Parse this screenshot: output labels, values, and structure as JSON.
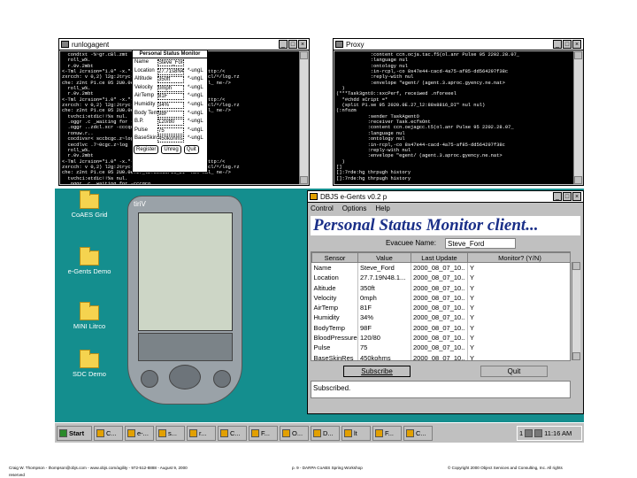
{
  "term1": {
    "title": "runlogagent",
    "lines": [
      "  condtxt -%~gr.cBl.zmt",
      "  roll_w%.",
      "  r.0v.2mbt",
      "<-Tml Jcrsion=\"1.0\" -x.\"-U. cMx logacccqe 6xKiE\" \"nttp:/<",
      "zxrcch: v 0,2) l2g:Jtryc- /ccz 2.15/icx7lx/bil7%cl2cl/^/log.rz",
      "che: z2nt P1.ce 95 2U0.0e.27_l2:86sd8/16_DI\" nul nul_ ne-/>",
      "  roll_w%.",
      "  r.0v.2mbt",
      "<-Tml Jcrsion=\"1.0\" -x.\"-U. cMx logacccqe 6xKiE\" \"nttp:/<",
      "zxrcch: v 0,2) l2g:Jtryc- /ccz 2.15/icx7lx/bil7%cl2cl/^/log.rz",
      "che: z2nt P1.ce 95 2U0.0e.27_l2:86sd8/16_DI\" nul nul_ ne-/>",
      "  tvchci:etdic!!%s nul.",
      "",
      "  .oggr .c _waiting for -cccqco",
      "  .oggr ..zdcl.xcr -cccqco",
      "  ronuw.r..",
      "  cocdivsr< sccbcgc.z~log",
      "  cecdlvc .7~0cgc.z~log",
      "  roll_w%.",
      "  r.0v.2mbt",
      "<-Tml Jcrsion=\"1.0\" -x.\"-U. cMx logacccqe 6xKiE\" \"nttp:/<",
      "zxrcch: v 0,2) l2g:Jtryc- /ccz 2.15/icx7lx/bil7%cl2cl/^/log.rz",
      "che: z2nt P1.ce 95 2U0.0e.27_l2:86sd8/16_DI\" nul nul_ ne-/>",
      "  tvchci:etdic!!%s nul.",
      "",
      "  .oggr .c _waiting for -cccqco",
      "  .oggr ..zdcl.xcr -cccqco"
    ]
  },
  "term2": {
    "title": "Proxy",
    "lines": [
      "            :content ccn.ocja.tac.f5(ol.anr Pulse 95 2202.28.07_",
      "            :language nul",
      "            :ontology nul",
      "            :in-rcpl,-co 8s47e44-cacd-4a75-af85-dd564297f38c",
      "            :reply-w1th nul",
      "            :envelope \"egent/ (agent.3.aproc.gyency.ne.nat>",
      "  )",
      "(***Task3gntO::sxcPerf, receiwed .nforeeel",
      "  *#chdd sCript =*",
      "  (split P1.se 95 2020.0E.27_l2:88s8816_DI\" nul nul)",
      "",
      "(:nfozm",
      "           :sender TaskAgentO",
      "           :receiver Task.ecfsOnt",
      "           :content ccn.oejagcc.t5(ol.anr Pulse 95 2202.28.07_",
      "           :language nul",
      "           :ontology nul",
      "           :in-rcpl,-co 8s47e44-cacd-4a75-af85-dd564297f38c",
      "           :reply-w1th nul",
      "           :envelope \"egent/ (agent.3.aproc.gyency.ne.nat>",
      "  )",
      "[]",
      "[]:7rde:hg thrpugh history",
      "[]:7rde:hg thrpugh history"
    ]
  },
  "desktop_icons": [
    "CoAES Grid",
    "e-Gents Demo",
    "MINI Litrco",
    "SDC Demo"
  ],
  "palm": {
    "title": "tiriV",
    "form_title": "Personal Status Monitor",
    "rows": [
      {
        "l": "Name",
        "v": "Steve_Ford",
        "a": ""
      },
      {
        "l": "Location",
        "v": "27.71s8N48.1",
        "a": "*-ungL"
      },
      {
        "l": "Altitude",
        "v": "350ft",
        "a": "*-ungL"
      },
      {
        "l": "Velocity",
        "v": "0mph",
        "a": "*-ungL"
      },
      {
        "l": "AirTemp",
        "v": "81F",
        "a": "*-ungL"
      },
      {
        "l": "Humidity",
        "v": "34%",
        "a": "*-ungL"
      },
      {
        "l": "Body Temp",
        "v": "98F",
        "a": "*-ungL"
      },
      {
        "l": "B.P.",
        "v": "120/80",
        "a": "*-ungL"
      },
      {
        "l": "Pulse",
        "v": "75",
        "a": "*-ungL"
      },
      {
        "l": "BaseSkin",
        "v": "450kohms",
        "a": "*-ungL"
      }
    ],
    "buttons": [
      "Register",
      "Unreg",
      "Quit"
    ]
  },
  "client": {
    "title": "DBJS e-Gents v0.2 p",
    "menu": [
      "Control",
      "Options",
      "Help"
    ],
    "heading": "Personal Status Monitor client...",
    "evacuee_label": "Evacuee Name:",
    "evacuee_value": "Steve_Ford",
    "columns": [
      "Sensor",
      "Value",
      "Last Update",
      "Monitor? (Y/N)"
    ],
    "rows": [
      [
        "Name",
        "Steve_Ford",
        "2000_08_07_10..",
        "Y"
      ],
      [
        "Location",
        "27.7.19N48.1...",
        "2000_08_07_10..",
        "Y"
      ],
      [
        "Altitude",
        "350ft",
        "2000_08_07_10..",
        "Y"
      ],
      [
        "Velocity",
        "0mph",
        "2000_08_07_10..",
        "Y"
      ],
      [
        "AirTemp",
        "81F",
        "2000_08_07_10..",
        "Y"
      ],
      [
        "Humidity",
        "34%",
        "2000_08_07_10..",
        "Y"
      ],
      [
        "BodyTemp",
        "98F",
        "2000_08_07_10..",
        "Y"
      ],
      [
        "BloodPressure",
        "120/80",
        "2000_08_07_10..",
        "Y"
      ],
      [
        "Pulse",
        "75",
        "2000_08_07_10..",
        "Y"
      ],
      [
        "BaseSkinRes",
        "450kohms",
        "2000_08_07_10..",
        "Y"
      ]
    ],
    "subscribe": "Subscribe",
    "quit": "Quit",
    "status": "Subscribed."
  },
  "taskbar": {
    "start": "Start",
    "items": [
      "C...",
      "e-...",
      "s...",
      "r...",
      "C...",
      "F...",
      "O...",
      "D...",
      "lt",
      "F...",
      "C..."
    ],
    "tray": "1",
    "clock": "11:16 AM"
  },
  "footer": {
    "left": "Craig W. Thompson - thompson@objs.com - www.objs.com/agility - 972-512-8888 - August 9, 2000",
    "left2": "reserved",
    "mid": "p. 9 - DARPA CoABS Spring Workshop",
    "right": "© Copyright 2000 Object Services and Consulting, Inc. All rights"
  }
}
